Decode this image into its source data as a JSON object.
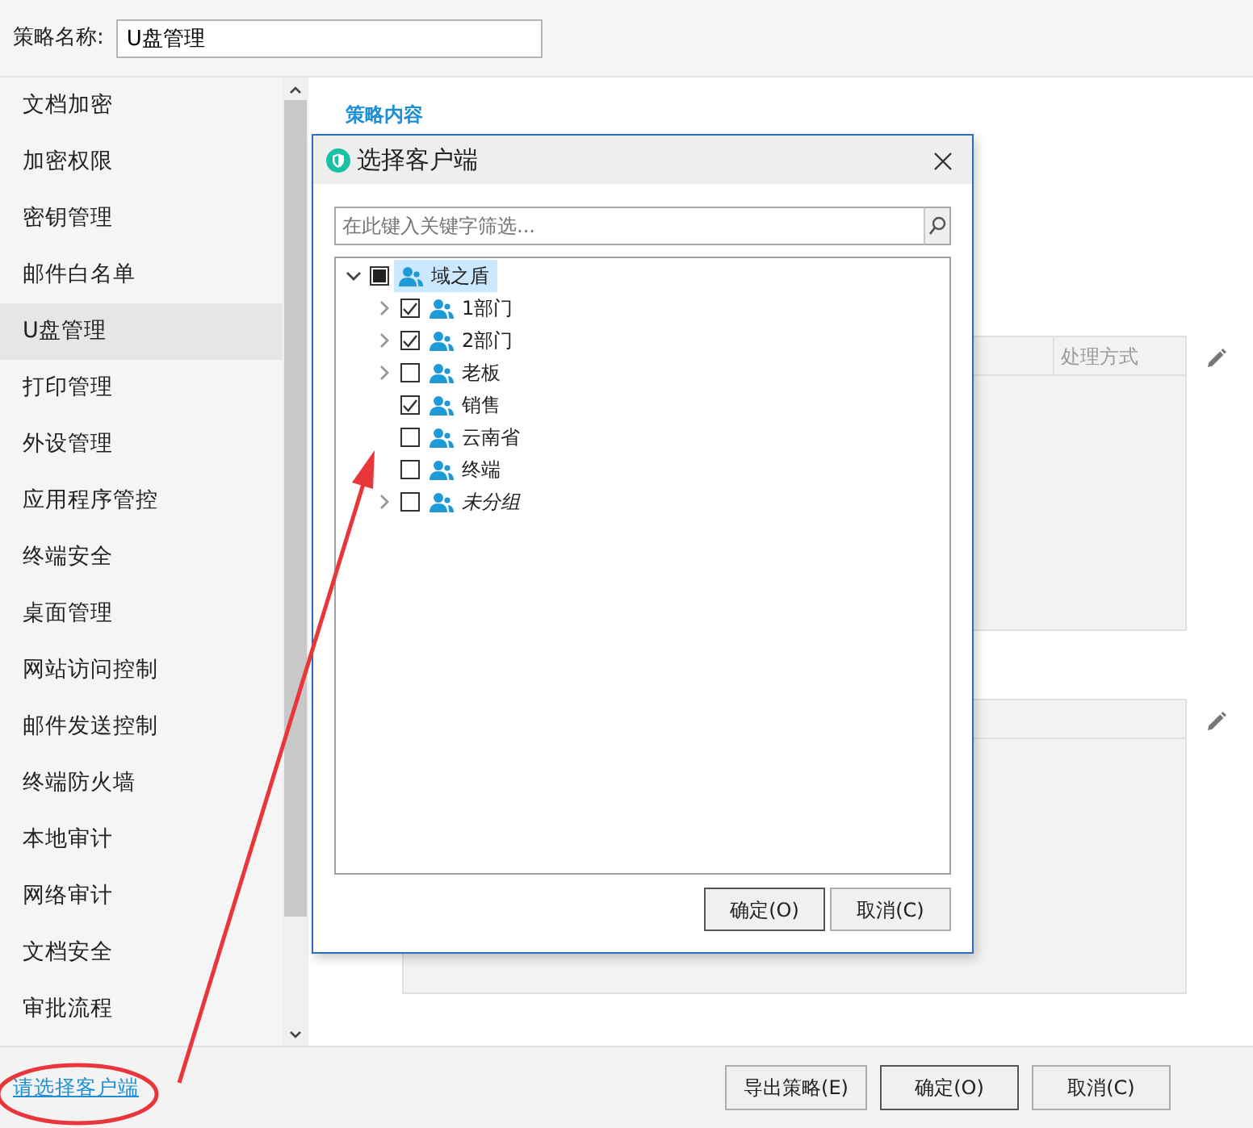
{
  "policy_name": {
    "label": "策略名称:",
    "value": "U盘管理"
  },
  "sidebar": {
    "items": [
      {
        "label": "文档加密",
        "selected": false
      },
      {
        "label": "加密权限",
        "selected": false
      },
      {
        "label": "密钥管理",
        "selected": false
      },
      {
        "label": "邮件白名单",
        "selected": false
      },
      {
        "label": "U盘管理",
        "selected": true
      },
      {
        "label": "打印管理",
        "selected": false
      },
      {
        "label": "外设管理",
        "selected": false
      },
      {
        "label": "应用程序管控",
        "selected": false
      },
      {
        "label": "终端安全",
        "selected": false
      },
      {
        "label": "桌面管理",
        "selected": false
      },
      {
        "label": "网站访问控制",
        "selected": false
      },
      {
        "label": "邮件发送控制",
        "selected": false
      },
      {
        "label": "终端防火墙",
        "selected": false
      },
      {
        "label": "本地审计",
        "selected": false
      },
      {
        "label": "网络审计",
        "selected": false
      },
      {
        "label": "文档安全",
        "selected": false
      },
      {
        "label": "审批流程",
        "selected": false
      }
    ]
  },
  "content": {
    "section_title": "策略内容",
    "table": {
      "columns": [
        "处理方式"
      ]
    }
  },
  "footer": {
    "link": "请选择客户端",
    "buttons": [
      {
        "label": "导出策略(E)",
        "default": false
      },
      {
        "label": "确定(O)",
        "default": true
      },
      {
        "label": "取消(C)",
        "default": false
      }
    ]
  },
  "dialog": {
    "title": "选择客户端",
    "search": {
      "placeholder": "在此键入关键字筛选..."
    },
    "tree": [
      {
        "label": "域之盾",
        "checked": false,
        "partial": true,
        "expandable": true,
        "expanded": true,
        "selected": true,
        "italic": false,
        "children": [
          {
            "label": "1部门",
            "checked": true,
            "expandable": true,
            "selected": false,
            "italic": false
          },
          {
            "label": "2部门",
            "checked": true,
            "expandable": true,
            "selected": false,
            "italic": false
          },
          {
            "label": "老板",
            "checked": false,
            "expandable": true,
            "selected": false,
            "italic": false
          },
          {
            "label": "销售",
            "checked": true,
            "expandable": false,
            "selected": false,
            "italic": false
          },
          {
            "label": "云南省",
            "checked": false,
            "expandable": false,
            "selected": false,
            "italic": false
          },
          {
            "label": "终端",
            "checked": false,
            "expandable": false,
            "selected": false,
            "italic": false
          },
          {
            "label": "未分组",
            "checked": false,
            "expandable": true,
            "selected": false,
            "italic": true
          }
        ]
      }
    ],
    "buttons": [
      {
        "label": "确定(O)",
        "default": true
      },
      {
        "label": "取消(C)",
        "default": false
      }
    ]
  }
}
